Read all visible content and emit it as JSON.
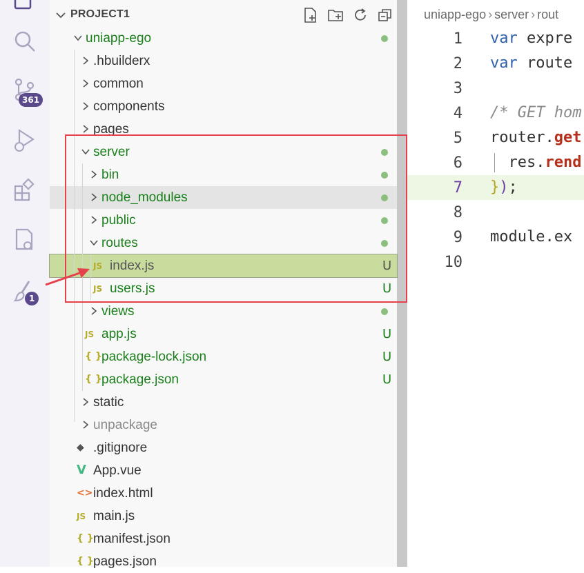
{
  "activity_bar": {
    "source_control_badge": "361",
    "extensions_badge": "1"
  },
  "explorer": {
    "project_title": "PROJECT1",
    "tree": [
      {
        "label": "uniapp-ego",
        "color": "#1b7f1b",
        "status": "dot"
      },
      {
        "label": ".hbuilderx",
        "color": "#333333"
      },
      {
        "label": "common",
        "color": "#333333"
      },
      {
        "label": "components",
        "color": "#333333"
      },
      {
        "label": "pages",
        "color": "#333333"
      },
      {
        "label": "server",
        "color": "#1b7f1b",
        "status": "dot"
      },
      {
        "label": "bin",
        "color": "#1b7f1b",
        "status": "dot"
      },
      {
        "label": "node_modules",
        "color": "#1b7f1b",
        "status": "dot"
      },
      {
        "label": "public",
        "color": "#1b7f1b",
        "status": "dot"
      },
      {
        "label": "routes",
        "color": "#1b7f1b",
        "status": "dot"
      },
      {
        "label": "index.js",
        "color": "#555555",
        "status": "U",
        "icon": "JS"
      },
      {
        "label": "users.js",
        "color": "#1b7f1b",
        "status": "U",
        "icon": "JS"
      },
      {
        "label": "views",
        "color": "#1b7f1b",
        "status": "dot"
      },
      {
        "label": "app.js",
        "color": "#1b7f1b",
        "status": "U",
        "icon": "JS"
      },
      {
        "label": "package-lock.json",
        "color": "#1b7f1b",
        "status": "U",
        "icon": "{ }"
      },
      {
        "label": "package.json",
        "color": "#1b7f1b",
        "status": "U",
        "icon": "{ }"
      },
      {
        "label": "static",
        "color": "#333333"
      },
      {
        "label": "unpackage",
        "color": "#8a8a8a"
      },
      {
        "label": ".gitignore",
        "color": "#333333",
        "icon": "git"
      },
      {
        "label": "App.vue",
        "color": "#333333",
        "icon": "V"
      },
      {
        "label": "index.html",
        "color": "#333333",
        "icon": "<>"
      },
      {
        "label": "main.js",
        "color": "#333333",
        "icon": "JS"
      },
      {
        "label": "manifest.json",
        "color": "#333333",
        "icon": "{ }"
      },
      {
        "label": "pages.json",
        "color": "#333333",
        "icon": "{ }"
      }
    ],
    "status_untracked": "U"
  },
  "editor": {
    "breadcrumb": [
      "uniapp-ego",
      "server",
      "rout"
    ],
    "line_numbers": [
      "1",
      "2",
      "3",
      "4",
      "5",
      "6",
      "7",
      "8",
      "9",
      "10"
    ],
    "code": {
      "l1_kw": "var",
      "l1_rest": " expre",
      "l2_kw": "var",
      "l2_rest": " route",
      "l4_comment": "/* GET hom",
      "l5_obj": "router.",
      "l5_fn": "get",
      "l6_obj": "res.",
      "l6_fn": "rend",
      "l7_brace": "}",
      "l7_paren": ")",
      "l7_semi": ";",
      "l9": "module.ex"
    }
  },
  "colors": {
    "accent_green": "#1b7f1b",
    "highlight_red": "#e4414a",
    "selected_row": "#c8dc9e",
    "git_dot": "#8cbf7d"
  }
}
